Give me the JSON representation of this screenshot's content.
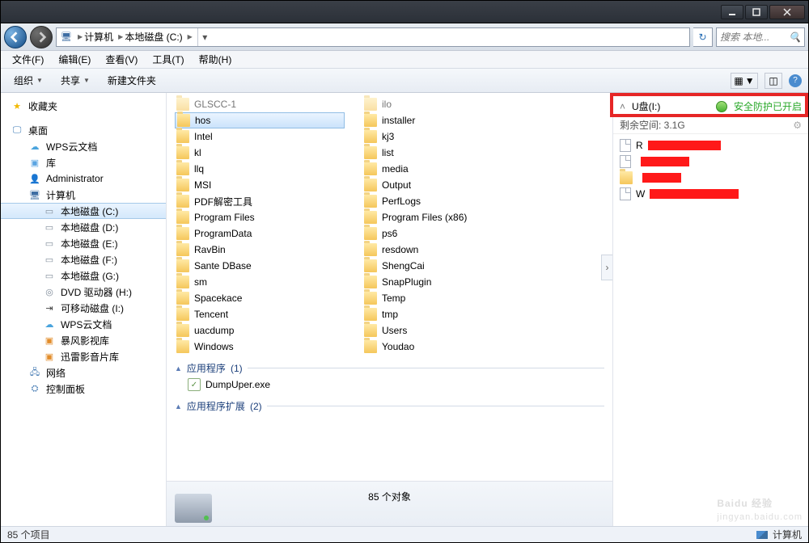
{
  "title_hidden": "",
  "breadcrumb": {
    "icon": "computer",
    "items": [
      "计算机",
      "本地磁盘 (C:)"
    ]
  },
  "search": {
    "placeholder": "搜索 本地..."
  },
  "menubar": [
    "文件(F)",
    "编辑(E)",
    "查看(V)",
    "工具(T)",
    "帮助(H)"
  ],
  "toolbar": {
    "organize": "组织",
    "share": "共享",
    "newfolder": "新建文件夹"
  },
  "navpane": {
    "favorites": "收藏夹",
    "desktop": "桌面",
    "desktop_children": [
      {
        "icon": "cloud",
        "label": "WPS云文档"
      },
      {
        "icon": "lib",
        "label": "库"
      },
      {
        "icon": "user",
        "label": "Administrator"
      }
    ],
    "computer": "计算机",
    "drives": [
      {
        "label": "本地磁盘 (C:)",
        "selected": true
      },
      {
        "label": "本地磁盘 (D:)"
      },
      {
        "label": "本地磁盘 (E:)"
      },
      {
        "label": "本地磁盘 (F:)"
      },
      {
        "label": "本地磁盘 (G:)"
      },
      {
        "label": "DVD 驱动器 (H:)",
        "icon": "dvd"
      },
      {
        "label": "可移动磁盘 (I:)",
        "icon": "usb"
      },
      {
        "label": "WPS云文档",
        "icon": "cloud"
      },
      {
        "label": "暴风影视库",
        "icon": "media"
      },
      {
        "label": "迅雷影音片库",
        "icon": "media2"
      }
    ],
    "network": "网络",
    "cpanel": "控制面板"
  },
  "folders_col1_top": [
    "GLSCC-1"
  ],
  "folders_col1": [
    "hos",
    "Intel",
    "kl",
    "llq",
    "MSI",
    "PDF解密工具",
    "Program Files",
    "ProgramData",
    "RavBin",
    "Sante DBase",
    "sm",
    "Spacekace",
    "Tencent",
    "uacdump",
    "Windows"
  ],
  "folders_col2_top": [
    "ilo"
  ],
  "folders_col2": [
    "installer",
    "kj3",
    "list",
    "media",
    "Output",
    "PerfLogs",
    "Program Files (x86)",
    "ps6",
    "resdown",
    "ShengCai",
    "SnapPlugin",
    "Temp",
    "tmp",
    "Users",
    "Youdao"
  ],
  "group_apps": {
    "label": "应用程序",
    "count": 1,
    "items": [
      "DumpUper.exe"
    ]
  },
  "group_ext": {
    "label": "应用程序扩展",
    "count": 2
  },
  "sidepanel": {
    "drive_label": "U盘(I:)",
    "status": "安全防护已开启",
    "freespace_label": "剩余空间: 3.1G",
    "items_prefix": [
      "R",
      "",
      "",
      "W"
    ]
  },
  "status": {
    "objects": "85 个对象"
  },
  "osbar": {
    "items_count": "85 个项目",
    "computer": "计算机"
  },
  "watermark": {
    "brand": "Baidu 经验",
    "url": "jingyan.baidu.com"
  }
}
